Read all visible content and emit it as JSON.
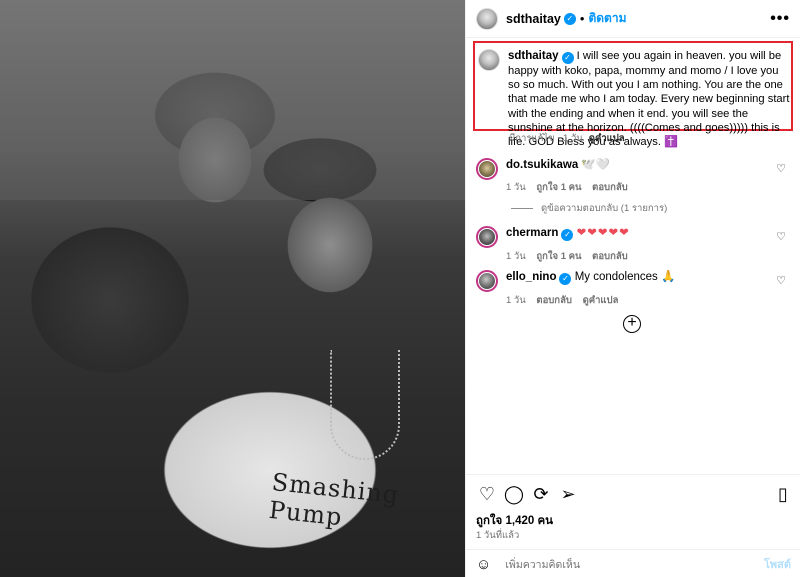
{
  "post_owner": {
    "username": "sdthaitay",
    "follow_label": "ติดตาม",
    "dot": "•",
    "more": "•••"
  },
  "caption": {
    "username": "sdthaitay",
    "text": "I will see you again in heaven. you will be happy with koko, papa, mommy and momo / I love you so so much. With out you I am nothing. You are the one that made me who I am today. Every new beginning start with the ending and when it end. you will see the sunshine at the horizon. ((((Comes and goes))))) this is life. GOD Bless you as always. ✝️",
    "meta": "มีการแก้ไข · 1 วัน",
    "translate": "ดูคำแปล"
  },
  "comments": [
    {
      "username": "do.tsukikawa",
      "verified": false,
      "text": "🕊️🤍",
      "meta_time": "1 วัน",
      "meta_likes": "ถูกใจ 1 คน",
      "meta_reply": "ตอบกลับ",
      "meta_translate": ""
    },
    {
      "username": "chermarn",
      "verified": true,
      "text": "❤❤❤❤❤",
      "meta_time": "1 วัน",
      "meta_likes": "ถูกใจ 1 คน",
      "meta_reply": "ตอบกลับ",
      "meta_translate": ""
    },
    {
      "username": "ello_nino",
      "verified": true,
      "text": "My condolences 🙏",
      "meta_time": "1 วัน",
      "meta_likes": "",
      "meta_reply": "ตอบกลับ",
      "meta_translate": "ดูคำแปล"
    }
  ],
  "view_replies": "ดูข้อความตอบกลับ (1 รายการ)",
  "actions": {
    "likes": "ถูกใจ 1,420 คน",
    "time": "1 วันที่แล้ว"
  },
  "add_comment": {
    "emoji": "☺",
    "placeholder": "เพิ่มความคิดเห็น",
    "post": "โพสต์"
  },
  "photo": {
    "shirt_text": "Smashing Pump"
  },
  "icons": {
    "like": "heart-icon",
    "comment": "comment-icon",
    "share": "repost-icon",
    "send": "send-icon",
    "save": "bookmark-icon",
    "more": "plus-circle-icon"
  },
  "colors": {
    "accent": "#0095f6",
    "highlight_box": "#e3262d",
    "heart": "#ed4956"
  }
}
